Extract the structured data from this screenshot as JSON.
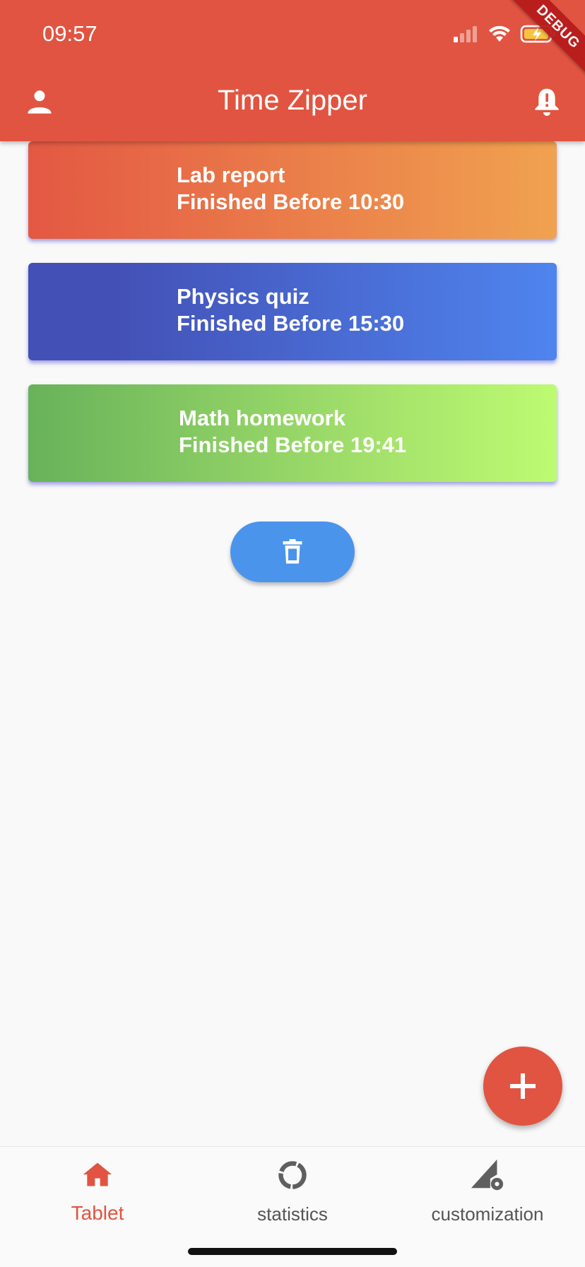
{
  "status_bar": {
    "time": "09:57",
    "debug_label": "DEBUG"
  },
  "app_bar": {
    "title": "Time Zipper"
  },
  "tasks": [
    {
      "name": "Lab report",
      "deadline": "Finished Before 10:30"
    },
    {
      "name": "Physics quiz",
      "deadline": "Finished Before 15:30"
    },
    {
      "name": "Math homework",
      "deadline": "Finished Before 19:41"
    }
  ],
  "bottom_nav": {
    "items": [
      {
        "label": "Tablet",
        "icon": "home-icon",
        "active": true
      },
      {
        "label": "statistics",
        "icon": "donut-chart-icon",
        "active": false
      },
      {
        "label": "customization",
        "icon": "signal-settings-icon",
        "active": false
      }
    ]
  },
  "colors": {
    "primary": "#e15441",
    "delete_button": "#4b94ec",
    "card_1": [
      "#e35843",
      "#f0a250"
    ],
    "card_2": [
      "#4350b5",
      "#4f84ee"
    ],
    "card_3": [
      "#68b25a",
      "#bdfb72"
    ]
  }
}
